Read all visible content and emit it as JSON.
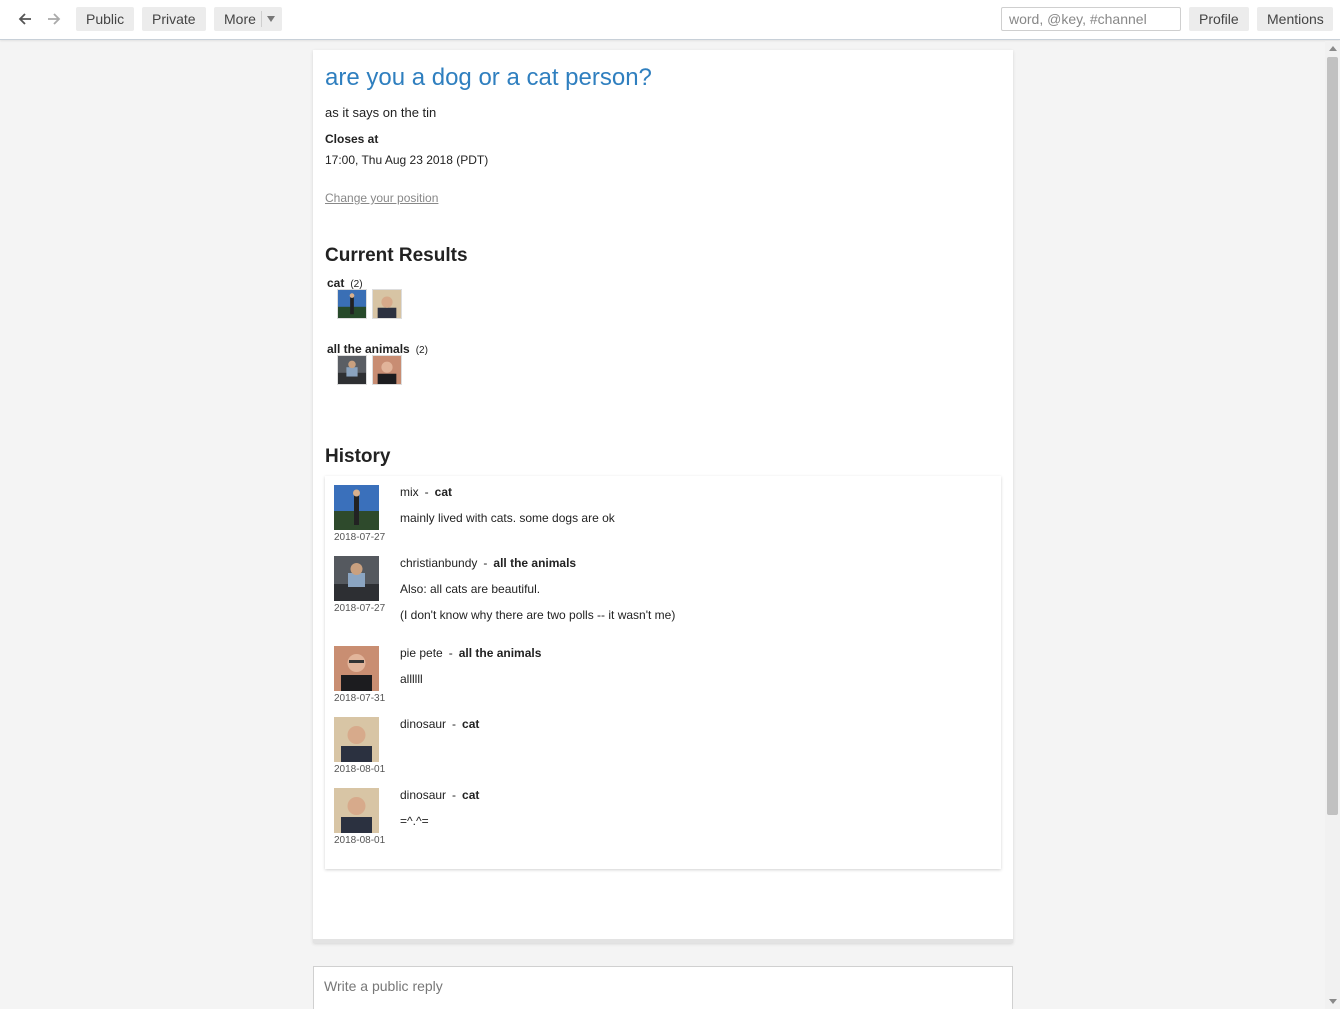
{
  "topbar": {
    "public": "Public",
    "private": "Private",
    "more": "More",
    "search_placeholder": "word, @key, #channel",
    "profile": "Profile",
    "mentions": "Mentions"
  },
  "poll": {
    "title": "are you a dog or a cat person?",
    "description": "as it says on the tin",
    "closes_label": "Closes at",
    "closes_value": "17:00, Thu Aug 23 2018 (PDT)",
    "change_position": "Change your position"
  },
  "results": {
    "heading": "Current Results",
    "groups": [
      {
        "label": "cat",
        "count": "(2)"
      },
      {
        "label": "all the animals",
        "count": "(2)"
      }
    ]
  },
  "history": {
    "heading": "History",
    "entries": [
      {
        "author": "mix",
        "position": "cat",
        "lines": [
          "mainly lived with cats. some dogs are ok"
        ],
        "date": "2018-07-27"
      },
      {
        "author": "christianbundy",
        "position": "all the animals",
        "lines": [
          "Also: all cats are beautiful.",
          "(I don't know why there are two polls -- it wasn't me)"
        ],
        "date": "2018-07-27"
      },
      {
        "author": "pie pete",
        "position": "all the animals",
        "lines": [
          "allllll"
        ],
        "date": "2018-07-31"
      },
      {
        "author": "dinosaur",
        "position": "cat",
        "lines": [],
        "date": "2018-08-01"
      },
      {
        "author": "dinosaur",
        "position": "cat",
        "lines": [
          "=^.^="
        ],
        "date": "2018-08-01"
      }
    ]
  },
  "reply": {
    "placeholder": "Write a public reply"
  }
}
